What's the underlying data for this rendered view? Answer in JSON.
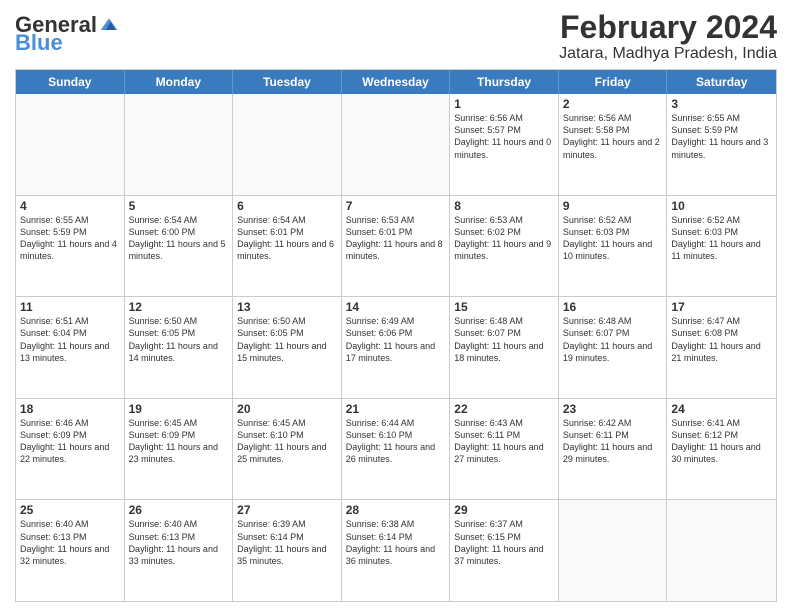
{
  "header": {
    "logo_line1": "General",
    "logo_line2": "Blue",
    "title": "February 2024",
    "subtitle": "Jatara, Madhya Pradesh, India"
  },
  "days_of_week": [
    "Sunday",
    "Monday",
    "Tuesday",
    "Wednesday",
    "Thursday",
    "Friday",
    "Saturday"
  ],
  "weeks": [
    [
      {
        "day": "",
        "empty": true,
        "text": ""
      },
      {
        "day": "",
        "empty": true,
        "text": ""
      },
      {
        "day": "",
        "empty": true,
        "text": ""
      },
      {
        "day": "",
        "empty": true,
        "text": ""
      },
      {
        "day": "1",
        "text": "Sunrise: 6:56 AM\nSunset: 5:57 PM\nDaylight: 11 hours and 0 minutes."
      },
      {
        "day": "2",
        "text": "Sunrise: 6:56 AM\nSunset: 5:58 PM\nDaylight: 11 hours and 2 minutes."
      },
      {
        "day": "3",
        "text": "Sunrise: 6:55 AM\nSunset: 5:59 PM\nDaylight: 11 hours and 3 minutes."
      }
    ],
    [
      {
        "day": "4",
        "text": "Sunrise: 6:55 AM\nSunset: 5:59 PM\nDaylight: 11 hours and 4 minutes."
      },
      {
        "day": "5",
        "text": "Sunrise: 6:54 AM\nSunset: 6:00 PM\nDaylight: 11 hours and 5 minutes."
      },
      {
        "day": "6",
        "text": "Sunrise: 6:54 AM\nSunset: 6:01 PM\nDaylight: 11 hours and 6 minutes."
      },
      {
        "day": "7",
        "text": "Sunrise: 6:53 AM\nSunset: 6:01 PM\nDaylight: 11 hours and 8 minutes."
      },
      {
        "day": "8",
        "text": "Sunrise: 6:53 AM\nSunset: 6:02 PM\nDaylight: 11 hours and 9 minutes."
      },
      {
        "day": "9",
        "text": "Sunrise: 6:52 AM\nSunset: 6:03 PM\nDaylight: 11 hours and 10 minutes."
      },
      {
        "day": "10",
        "text": "Sunrise: 6:52 AM\nSunset: 6:03 PM\nDaylight: 11 hours and 11 minutes."
      }
    ],
    [
      {
        "day": "11",
        "text": "Sunrise: 6:51 AM\nSunset: 6:04 PM\nDaylight: 11 hours and 13 minutes."
      },
      {
        "day": "12",
        "text": "Sunrise: 6:50 AM\nSunset: 6:05 PM\nDaylight: 11 hours and 14 minutes."
      },
      {
        "day": "13",
        "text": "Sunrise: 6:50 AM\nSunset: 6:05 PM\nDaylight: 11 hours and 15 minutes."
      },
      {
        "day": "14",
        "text": "Sunrise: 6:49 AM\nSunset: 6:06 PM\nDaylight: 11 hours and 17 minutes."
      },
      {
        "day": "15",
        "text": "Sunrise: 6:48 AM\nSunset: 6:07 PM\nDaylight: 11 hours and 18 minutes."
      },
      {
        "day": "16",
        "text": "Sunrise: 6:48 AM\nSunset: 6:07 PM\nDaylight: 11 hours and 19 minutes."
      },
      {
        "day": "17",
        "text": "Sunrise: 6:47 AM\nSunset: 6:08 PM\nDaylight: 11 hours and 21 minutes."
      }
    ],
    [
      {
        "day": "18",
        "text": "Sunrise: 6:46 AM\nSunset: 6:09 PM\nDaylight: 11 hours and 22 minutes."
      },
      {
        "day": "19",
        "text": "Sunrise: 6:45 AM\nSunset: 6:09 PM\nDaylight: 11 hours and 23 minutes."
      },
      {
        "day": "20",
        "text": "Sunrise: 6:45 AM\nSunset: 6:10 PM\nDaylight: 11 hours and 25 minutes."
      },
      {
        "day": "21",
        "text": "Sunrise: 6:44 AM\nSunset: 6:10 PM\nDaylight: 11 hours and 26 minutes."
      },
      {
        "day": "22",
        "text": "Sunrise: 6:43 AM\nSunset: 6:11 PM\nDaylight: 11 hours and 27 minutes."
      },
      {
        "day": "23",
        "text": "Sunrise: 6:42 AM\nSunset: 6:11 PM\nDaylight: 11 hours and 29 minutes."
      },
      {
        "day": "24",
        "text": "Sunrise: 6:41 AM\nSunset: 6:12 PM\nDaylight: 11 hours and 30 minutes."
      }
    ],
    [
      {
        "day": "25",
        "text": "Sunrise: 6:40 AM\nSunset: 6:13 PM\nDaylight: 11 hours and 32 minutes."
      },
      {
        "day": "26",
        "text": "Sunrise: 6:40 AM\nSunset: 6:13 PM\nDaylight: 11 hours and 33 minutes."
      },
      {
        "day": "27",
        "text": "Sunrise: 6:39 AM\nSunset: 6:14 PM\nDaylight: 11 hours and 35 minutes."
      },
      {
        "day": "28",
        "text": "Sunrise: 6:38 AM\nSunset: 6:14 PM\nDaylight: 11 hours and 36 minutes."
      },
      {
        "day": "29",
        "text": "Sunrise: 6:37 AM\nSunset: 6:15 PM\nDaylight: 11 hours and 37 minutes."
      },
      {
        "day": "",
        "empty": true,
        "text": ""
      },
      {
        "day": "",
        "empty": true,
        "text": ""
      }
    ]
  ]
}
